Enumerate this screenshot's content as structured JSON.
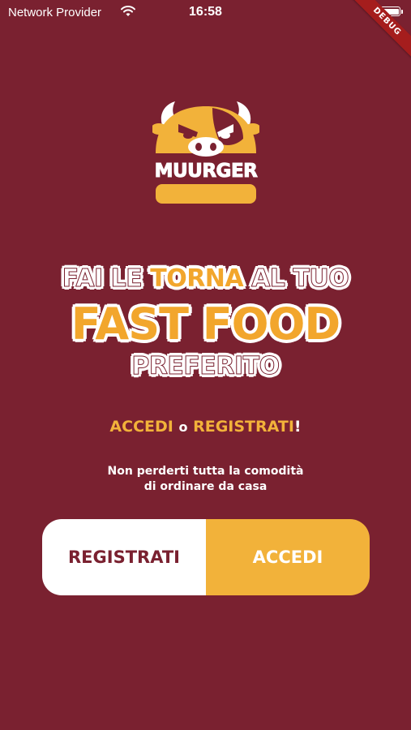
{
  "status_bar": {
    "carrier": "Network Provider",
    "time": "16:58",
    "wifi_icon": "wifi-icon",
    "battery_icon": "battery-icon"
  },
  "debug_banner": "DEBUG",
  "logo": {
    "icon": "muurger-bull-burger-logo",
    "brand": "MUURGER"
  },
  "headline": {
    "line1": [
      "FAI",
      "LE",
      "TORNA",
      "AL",
      "TUO"
    ],
    "line2": "FAST FOOD",
    "line3": "PREFERITO"
  },
  "cta": {
    "accedi": "ACCEDI",
    "or": "o",
    "registrati": "REGISTRATI",
    "excl": "!"
  },
  "subtitle": {
    "line1": "Non perderti tutta la comodità",
    "line2": "di ordinare da casa"
  },
  "buttons": {
    "register": "REGISTRATI",
    "login": "ACCEDI"
  },
  "colors": {
    "background": "#7a2130",
    "accent": "#f2b23a",
    "white": "#ffffff"
  }
}
